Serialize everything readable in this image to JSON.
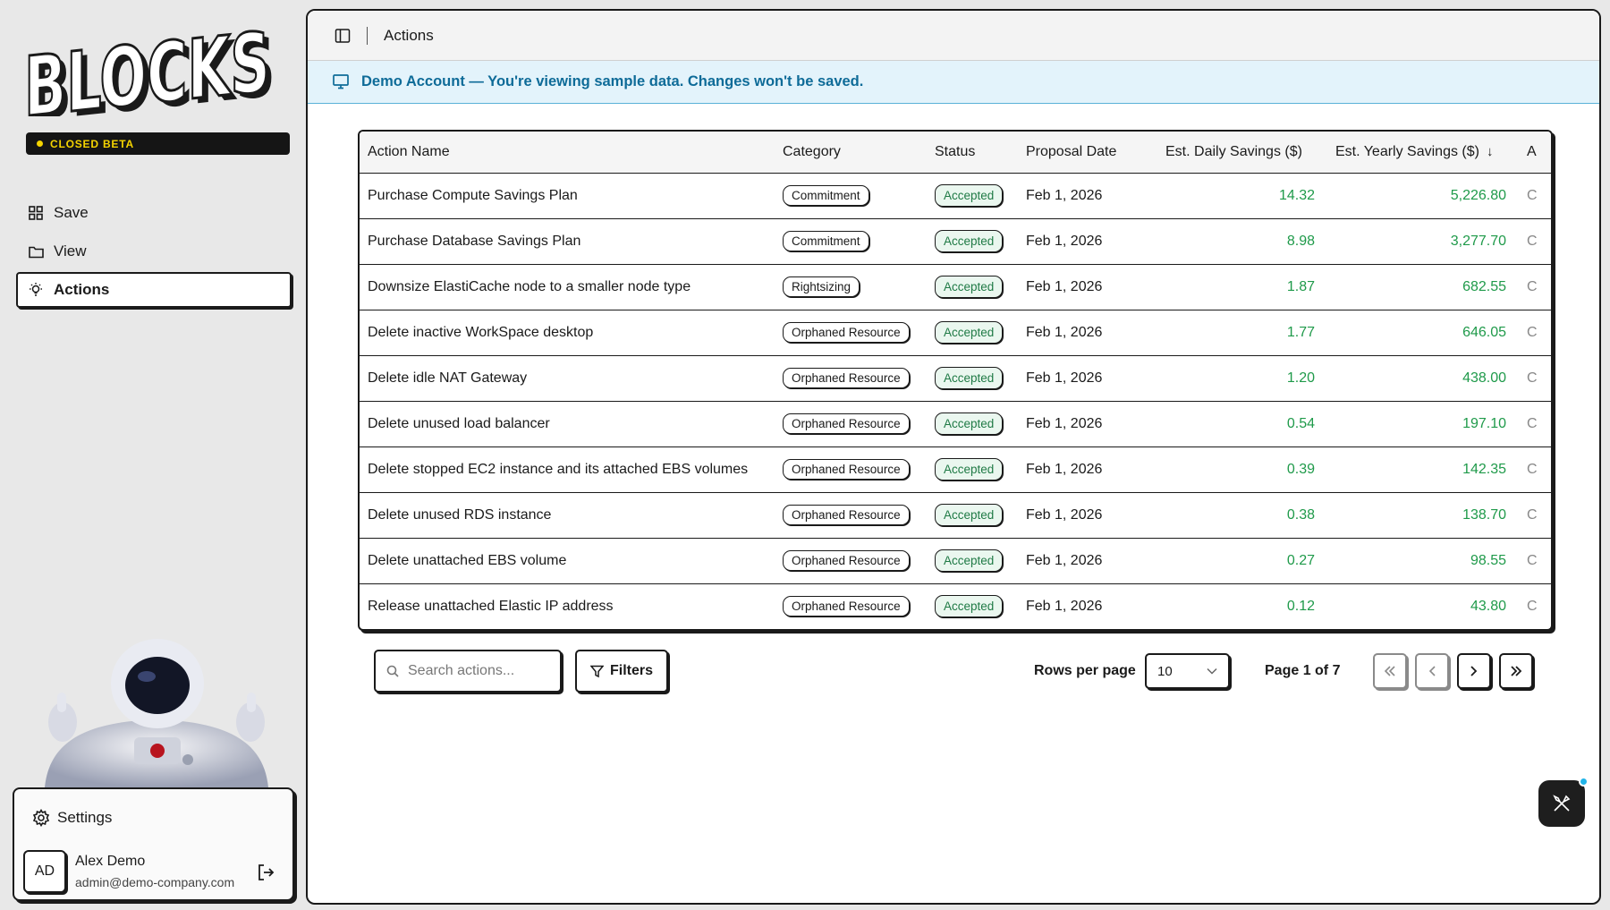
{
  "app": {
    "logo_text": "BLOCKS",
    "beta_label": "CLOSED BETA"
  },
  "sidebar": {
    "items": [
      {
        "label": "Save",
        "icon": "grid-icon"
      },
      {
        "label": "View",
        "icon": "folder-icon"
      },
      {
        "label": "Actions",
        "icon": "lightbulb-icon",
        "active": true
      }
    ],
    "settings_label": "Settings",
    "user": {
      "initials": "AD",
      "name": "Alex Demo",
      "email": "admin@demo-company.com"
    }
  },
  "header": {
    "breadcrumb": "Actions"
  },
  "banner": {
    "text": "Demo Account — You're viewing sample data. Changes won't be saved."
  },
  "table": {
    "columns": [
      "Action Name",
      "Category",
      "Status",
      "Proposal Date",
      "Est. Daily Savings ($)",
      "Est. Yearly Savings ($)",
      "A"
    ],
    "sort_icon": "↓",
    "rows": [
      {
        "name": "Purchase Compute Savings Plan",
        "category": "Commitment",
        "status": "Accepted",
        "date": "Feb 1, 2026",
        "daily": "14.32",
        "yearly": "5,226.80",
        "cut": "C"
      },
      {
        "name": "Purchase Database Savings Plan",
        "category": "Commitment",
        "status": "Accepted",
        "date": "Feb 1, 2026",
        "daily": "8.98",
        "yearly": "3,277.70",
        "cut": "C"
      },
      {
        "name": "Downsize ElastiCache node to a smaller node type",
        "category": "Rightsizing",
        "status": "Accepted",
        "date": "Feb 1, 2026",
        "daily": "1.87",
        "yearly": "682.55",
        "cut": "C"
      },
      {
        "name": "Delete inactive WorkSpace desktop",
        "category": "Orphaned Resource",
        "status": "Accepted",
        "date": "Feb 1, 2026",
        "daily": "1.77",
        "yearly": "646.05",
        "cut": "C"
      },
      {
        "name": "Delete idle NAT Gateway",
        "category": "Orphaned Resource",
        "status": "Accepted",
        "date": "Feb 1, 2026",
        "daily": "1.20",
        "yearly": "438.00",
        "cut": "C"
      },
      {
        "name": "Delete unused load balancer",
        "category": "Orphaned Resource",
        "status": "Accepted",
        "date": "Feb 1, 2026",
        "daily": "0.54",
        "yearly": "197.10",
        "cut": "C"
      },
      {
        "name": "Delete stopped EC2 instance and its attached EBS volumes",
        "category": "Orphaned Resource",
        "status": "Accepted",
        "date": "Feb 1, 2026",
        "daily": "0.39",
        "yearly": "142.35",
        "cut": "C"
      },
      {
        "name": "Delete unused RDS instance",
        "category": "Orphaned Resource",
        "status": "Accepted",
        "date": "Feb 1, 2026",
        "daily": "0.38",
        "yearly": "138.70",
        "cut": "C"
      },
      {
        "name": "Delete unattached EBS volume",
        "category": "Orphaned Resource",
        "status": "Accepted",
        "date": "Feb 1, 2026",
        "daily": "0.27",
        "yearly": "98.55",
        "cut": "C"
      },
      {
        "name": "Release unattached Elastic IP address",
        "category": "Orphaned Resource",
        "status": "Accepted",
        "date": "Feb 1, 2026",
        "daily": "0.12",
        "yearly": "43.80",
        "cut": "C"
      }
    ]
  },
  "controls": {
    "search_placeholder": "Search actions...",
    "filters_label": "Filters",
    "rows_per_page_label": "Rows per page",
    "rows_per_page_value": "10",
    "page_info": "Page 1 of 7"
  },
  "colors": {
    "accent_yellow": "#f5d400",
    "savings_green": "#1f9a4a",
    "banner_blue": "#0e6b98",
    "banner_bg": "#e3f3fb"
  }
}
